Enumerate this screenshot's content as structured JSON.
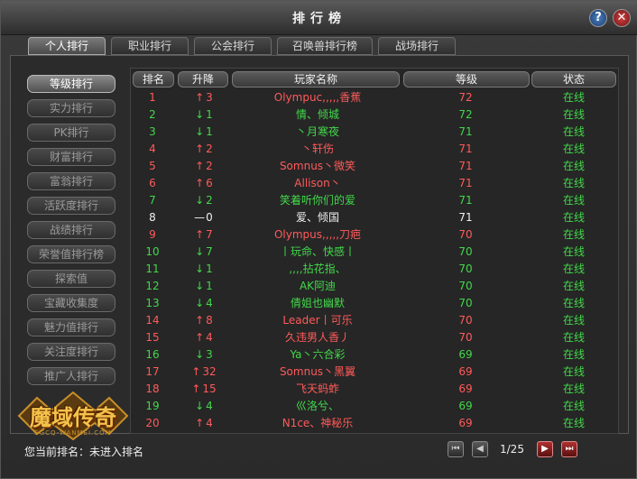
{
  "window": {
    "title": "排行榜",
    "help_label": "?",
    "close_label": "✕"
  },
  "tabs": [
    {
      "label": "个人排行",
      "active": true
    },
    {
      "label": "职业排行",
      "active": false
    },
    {
      "label": "公会排行",
      "active": false
    },
    {
      "label": "召唤兽排行榜",
      "active": false
    },
    {
      "label": "战场排行",
      "active": false
    }
  ],
  "sidebar": [
    {
      "label": "等级排行",
      "active": true
    },
    {
      "label": "实力排行",
      "active": false
    },
    {
      "label": "PK排行",
      "active": false
    },
    {
      "label": "财富排行",
      "active": false
    },
    {
      "label": "富翁排行",
      "active": false
    },
    {
      "label": "活跃度排行",
      "active": false
    },
    {
      "label": "战绩排行",
      "active": false
    },
    {
      "label": "荣誉值排行榜",
      "active": false
    },
    {
      "label": "探索值",
      "active": false
    },
    {
      "label": "宝藏收集度",
      "active": false
    },
    {
      "label": "魅力值排行",
      "active": false
    },
    {
      "label": "关注度排行",
      "active": false
    },
    {
      "label": "推广人排行",
      "active": false
    }
  ],
  "logo": {
    "text": "魔域传奇",
    "subtext": "SGCQ-WANMEI.COM"
  },
  "table": {
    "headers": [
      "排名",
      "升降",
      "玩家名称",
      "等级",
      "状态"
    ],
    "rows": [
      {
        "rank": "1",
        "dir": "↑",
        "change": "3",
        "name": "Olympuc,,,,,香蕉",
        "level": "72",
        "status": "在线",
        "color": "#ff5a5a"
      },
      {
        "rank": "2",
        "dir": "↓",
        "change": "1",
        "name": "情、倾城",
        "level": "72",
        "status": "在线",
        "color": "#42d84a"
      },
      {
        "rank": "3",
        "dir": "↓",
        "change": "1",
        "name": "丶月寒夜",
        "level": "71",
        "status": "在线",
        "color": "#42d84a"
      },
      {
        "rank": "4",
        "dir": "↑",
        "change": "2",
        "name": "丶轩伤",
        "level": "71",
        "status": "在线",
        "color": "#ff5a5a"
      },
      {
        "rank": "5",
        "dir": "↑",
        "change": "2",
        "name": "Somnus丶微笑",
        "level": "71",
        "status": "在线",
        "color": "#ff5a5a"
      },
      {
        "rank": "6",
        "dir": "↑",
        "change": "6",
        "name": "Allison丶",
        "level": "71",
        "status": "在线",
        "color": "#ff5a5a"
      },
      {
        "rank": "7",
        "dir": "↓",
        "change": "2",
        "name": "笑着听你们的爱",
        "level": "71",
        "status": "在线",
        "color": "#42d84a"
      },
      {
        "rank": "8",
        "dir": "—",
        "change": "0",
        "name": "爱、倾国",
        "level": "71",
        "status": "在线",
        "color": "#f0f0f0"
      },
      {
        "rank": "9",
        "dir": "↑",
        "change": "7",
        "name": "Olympus,,,,,刀疤",
        "level": "70",
        "status": "在线",
        "color": "#ff5a5a"
      },
      {
        "rank": "10",
        "dir": "↓",
        "change": "7",
        "name": "丨玩命、快感丨",
        "level": "70",
        "status": "在线",
        "color": "#42d84a"
      },
      {
        "rank": "11",
        "dir": "↓",
        "change": "1",
        "name": ",,,,拈花指、",
        "level": "70",
        "status": "在线",
        "color": "#42d84a"
      },
      {
        "rank": "12",
        "dir": "↓",
        "change": "1",
        "name": "AK阿迪",
        "level": "70",
        "status": "在线",
        "color": "#42d84a"
      },
      {
        "rank": "13",
        "dir": "↓",
        "change": "4",
        "name": "倩姐也幽默",
        "level": "70",
        "status": "在线",
        "color": "#42d84a"
      },
      {
        "rank": "14",
        "dir": "↑",
        "change": "8",
        "name": "Leader丨可乐",
        "level": "70",
        "status": "在线",
        "color": "#ff5a5a"
      },
      {
        "rank": "15",
        "dir": "↑",
        "change": "4",
        "name": "久违男人香丿",
        "level": "70",
        "status": "在线",
        "color": "#ff5a5a"
      },
      {
        "rank": "16",
        "dir": "↓",
        "change": "3",
        "name": "Ya丶六合彩",
        "level": "69",
        "status": "在线",
        "color": "#42d84a"
      },
      {
        "rank": "17",
        "dir": "↑",
        "change": "32",
        "name": "Somnus丶黑翼",
        "level": "69",
        "status": "在线",
        "color": "#ff5a5a"
      },
      {
        "rank": "18",
        "dir": "↑",
        "change": "15",
        "name": "飞天蚂蚱",
        "level": "69",
        "status": "在线",
        "color": "#ff5a5a"
      },
      {
        "rank": "19",
        "dir": "↓",
        "change": "4",
        "name": "巛洛兮、",
        "level": "69",
        "status": "在线",
        "color": "#42d84a"
      },
      {
        "rank": "20",
        "dir": "↑",
        "change": "4",
        "name": "N1ce、神秘乐",
        "level": "69",
        "status": "在线",
        "color": "#ff5a5a"
      }
    ],
    "status_color": "#42d84a"
  },
  "footer": {
    "my_rank_label": "您当前排名：未进入排名",
    "page_text": "1/25",
    "first_icon": "⏮",
    "prev_icon": "◀",
    "next_icon": "▶",
    "last_icon": "⏭"
  }
}
